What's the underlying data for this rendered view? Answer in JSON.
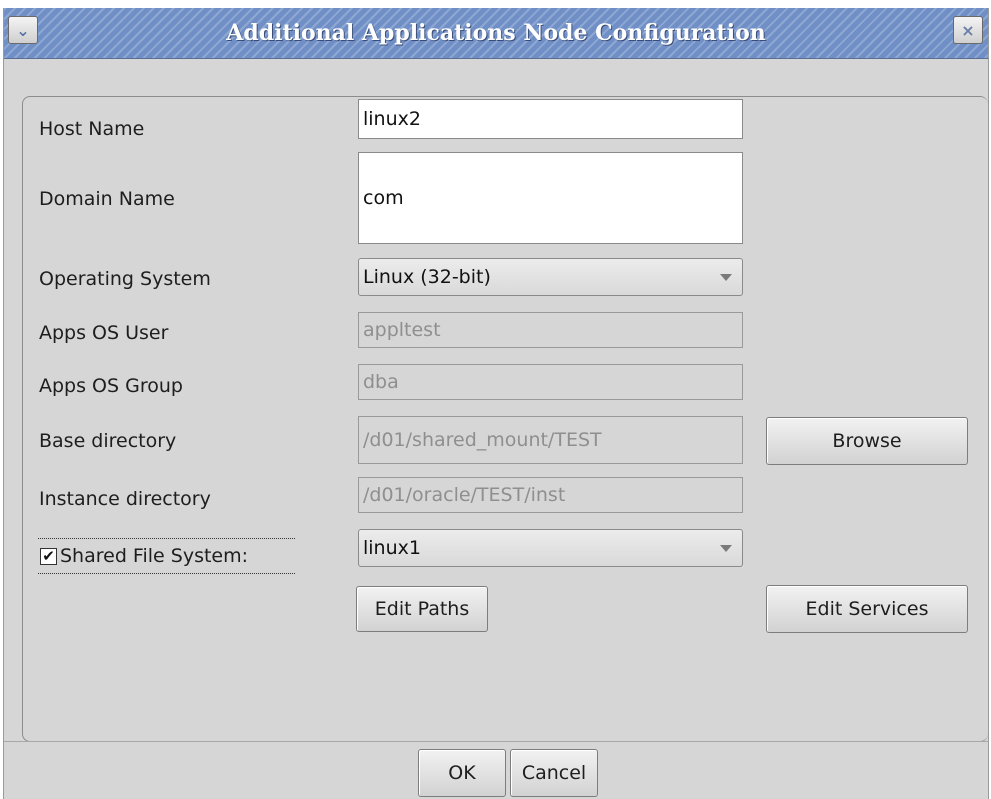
{
  "window": {
    "title": "Additional Applications Node Configuration",
    "menu_glyph": "⌄",
    "close_glyph": "×"
  },
  "form": {
    "host_name": {
      "label": "Host Name",
      "value": "linux2"
    },
    "domain_name": {
      "label": "Domain Name",
      "value": "com"
    },
    "operating_system": {
      "label": "Operating System",
      "value": "Linux (32-bit)"
    },
    "apps_os_user": {
      "label": "Apps OS User",
      "value": "appltest"
    },
    "apps_os_group": {
      "label": "Apps OS Group",
      "value": "dba"
    },
    "base_directory": {
      "label": "Base directory",
      "value": "/d01/shared_mount/TEST"
    },
    "instance_directory": {
      "label": "Instance directory",
      "value": "/d01/oracle/TEST/inst"
    },
    "shared_file_system": {
      "label": "Shared File System:",
      "checked": true,
      "value": "linux1"
    }
  },
  "buttons": {
    "browse": "Browse",
    "edit_paths": "Edit Paths",
    "edit_services": "Edit Services",
    "ok": "OK",
    "cancel": "Cancel"
  },
  "colors": {
    "titlebar": "#6f8fc6",
    "window_bg": "#d6d6d6",
    "disabled_text": "#8f8f8f"
  }
}
